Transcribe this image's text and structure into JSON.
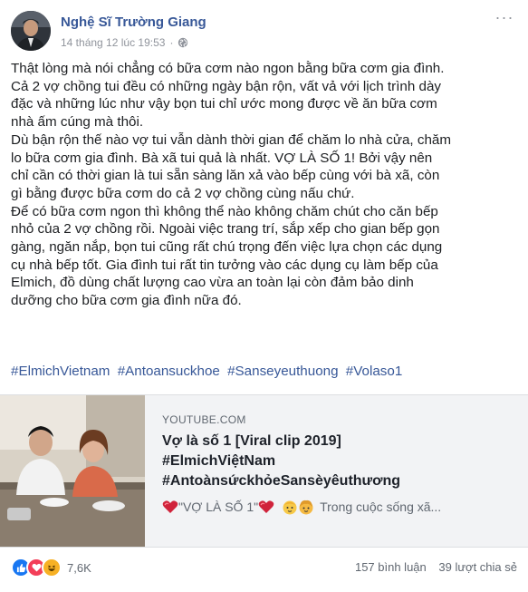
{
  "post": {
    "author": "Nghệ Sĩ Trường Giang",
    "timestamp": "14 tháng 12 lúc 19:53",
    "dot": "·",
    "more_label": "···",
    "paragraphs": [
      "Thật lòng mà nói chẳng có bữa cơm nào ngon bằng bữa cơm gia đình.",
      "Cả 2 vợ chồng tui đều có những ngày bận rộn, vất vả với lịch trình dày",
      "đặc và những lúc như vậy bọn tui chỉ ước mong được về ăn bữa cơm",
      "nhà ấm cúng mà thôi.",
      "Dù bận rộn thế nào vợ tui vẫn dành thời gian để chăm lo nhà cửa, chăm",
      "lo bữa cơm gia đình. Bà xã tui quả là nhất. VỢ LÀ SỐ 1! Bởi vậy nên",
      "chỉ cần có thời gian là tui sẵn sàng lăn xả vào bếp cùng với bà xã, còn",
      "gì bằng được bữa cơm do cả 2 vợ chồng cùng nấu chứ.",
      "Để có bữa cơm ngon thì không thể nào không chăm chút cho căn bếp",
      "nhỏ của 2 vợ chồng rồi. Ngoài việc trang trí, sắp xếp cho gian bếp gọn",
      "gàng, ngăn nắp, bọn tui cũng rất chú trọng đến việc lựa chọn các dụng",
      "cụ nhà bếp tốt. Gia đình tui rất tin tưởng vào các dụng cụ làm bếp của",
      "Elmich, đồ dùng chất lượng cao vừa an toàn lại còn đảm bảo dinh",
      "dưỡng cho bữa cơm gia đình nữa đó."
    ],
    "hashtags": [
      "#ElmichVietnam",
      "#Antoansuckhoe",
      "#Sanseyeuthuong",
      "#Volaso1"
    ]
  },
  "link_preview": {
    "domain": "YOUTUBE.COM",
    "title_lines": [
      "Vợ là số 1 [Viral clip 2019]",
      "#ElmichViệtNam",
      "#AntoànsứckhỏeSansèyêuthương"
    ],
    "desc_quote": "\"VỢ LÀ SỐ 1\"",
    "desc_tail": "Trong cuộc sống xã..."
  },
  "footer": {
    "reaction_count": "7,6K",
    "comments": "157 bình luận",
    "shares": "39 lượt chia sẻ"
  },
  "colors": {
    "author": "#385898",
    "like": "#1877f2",
    "love": "#f33e58",
    "haha": "#f7b125"
  },
  "icons": [
    "globe-icon",
    "more-options-icon",
    "like-reaction-icon",
    "love-reaction-icon",
    "haha-reaction-icon",
    "heart-emoji-icon",
    "baby-emoji-icon"
  ]
}
